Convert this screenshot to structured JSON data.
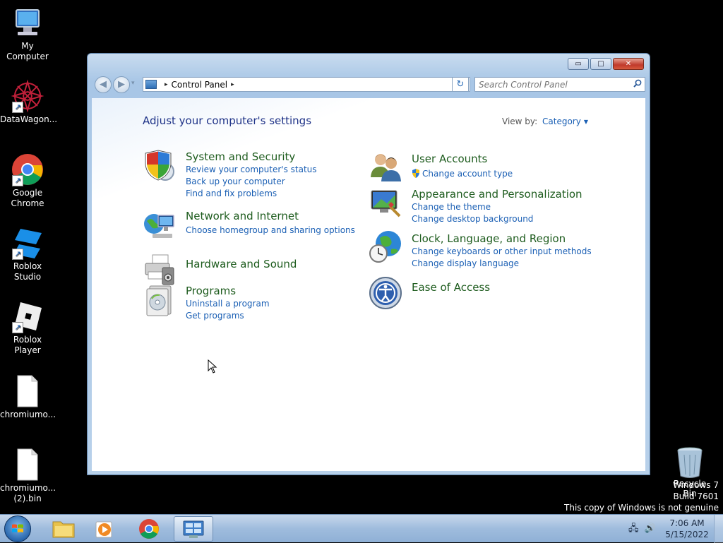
{
  "desktop": {
    "icons": [
      {
        "label": "My Computer"
      },
      {
        "label": "DataWagon..."
      },
      {
        "label": "Google Chrome"
      },
      {
        "label": "Roblox Studio"
      },
      {
        "label": "Roblox Player"
      },
      {
        "label": "chromiumo..."
      },
      {
        "label": "chromiumo... (2).bin"
      }
    ],
    "recycle_bin": {
      "label": "Recycle Bin"
    },
    "watermark": {
      "line1": "Windows 7",
      "line2": "Build 7601",
      "line3": "This copy of Windows is not genuine"
    }
  },
  "window": {
    "buttons": {
      "minimize": "▭",
      "maximize": "□",
      "close": "✕"
    },
    "nav": {
      "back": "◀",
      "forward": "▶",
      "dropdown": "▾"
    },
    "address": {
      "separator": "▸",
      "crumb": "Control Panel",
      "end_separator": "▸",
      "dropdown": "▾"
    },
    "refresh": "↻",
    "search": {
      "placeholder": "Search Control Panel",
      "icon": "search-icon"
    },
    "heading": "Adjust your computer's settings",
    "view_by": {
      "label": "View by:",
      "value": "Category",
      "arrow": "▼"
    },
    "categories": [
      {
        "title": "System and Security",
        "icon": "shield-icon",
        "links": [
          "Review your computer's status",
          "Back up your computer",
          "Find and fix problems"
        ]
      },
      {
        "title": "Network and Internet",
        "icon": "network-icon",
        "links": [
          "Choose homegroup and sharing options"
        ]
      },
      {
        "title": "Hardware and Sound",
        "icon": "printer-icon",
        "links": []
      },
      {
        "title": "Programs",
        "icon": "programs-icon",
        "links": [
          "Uninstall a program",
          "Get programs"
        ]
      },
      {
        "title": "User Accounts",
        "icon": "users-icon",
        "links": [
          "Change account type"
        ]
      },
      {
        "title": "Appearance and Personalization",
        "icon": "appearance-icon",
        "links": [
          "Change the theme",
          "Change desktop background"
        ]
      },
      {
        "title": "Clock, Language, and Region",
        "icon": "globe-clock-icon",
        "links": [
          "Change keyboards or other input methods",
          "Change display language"
        ]
      },
      {
        "title": "Ease of Access",
        "icon": "ease-of-access-icon",
        "links": []
      }
    ]
  },
  "taskbar": {
    "items": [
      "start-button",
      "explorer",
      "media-player",
      "chrome",
      "control-panel"
    ],
    "clock": {
      "time": "7:06 AM",
      "date": "5/15/2022"
    },
    "tray": {
      "network": "🖧",
      "volume": "🔊"
    }
  },
  "colors": {
    "desktop_bg": "#000000",
    "category_title": "#1e5c1e",
    "link": "#1a5fb4",
    "heading": "#1e3287"
  }
}
